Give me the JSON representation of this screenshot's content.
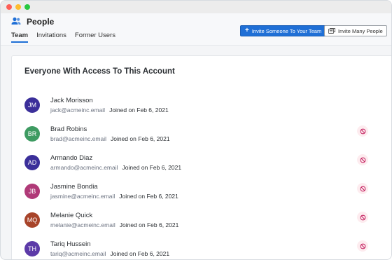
{
  "header": {
    "title": "People",
    "tabs": [
      {
        "label": "Team",
        "active": true
      },
      {
        "label": "Invitations",
        "active": false
      },
      {
        "label": "Former Users",
        "active": false
      }
    ],
    "invite_button": "Invite Someone To Your Team",
    "invite_many_button": "Invite Many People"
  },
  "card": {
    "title": "Everyone With Access To This Account"
  },
  "colors": {
    "accent": "#1f6fd6",
    "remove_icon": "#c2185b"
  },
  "users": [
    {
      "initials": "JM",
      "name": "Jack Morisson",
      "email": "jack@acmeinc.email",
      "joined": "Joined on Feb 6, 2021",
      "avatar_color": "#3b2f9a",
      "removable": false
    },
    {
      "initials": "BR",
      "name": "Brad Robins",
      "email": "brad@acmeinc.email",
      "joined": "Joined on Feb 6, 2021",
      "avatar_color": "#3e9b62",
      "removable": true
    },
    {
      "initials": "AD",
      "name": "Armando Diaz",
      "email": "armando@acmeinc.email",
      "joined": "Joined on Feb 6, 2021",
      "avatar_color": "#3b2f9a",
      "removable": true
    },
    {
      "initials": "JB",
      "name": "Jasmine Bondia",
      "email": "jasmine@acmeinc.email",
      "joined": "Joined on Feb 6, 2021",
      "avatar_color": "#b03a78",
      "removable": true
    },
    {
      "initials": "MQ",
      "name": "Melanie Quick",
      "email": "melanie@acmeinc.email",
      "joined": "Joined on Feb 6, 2021",
      "avatar_color": "#a8442a",
      "removable": true
    },
    {
      "initials": "TH",
      "name": "Tariq Hussein",
      "email": "tariq@acmeinc.email",
      "joined": "Joined on Feb 6, 2021",
      "avatar_color": "#5c3aa8",
      "removable": true
    }
  ]
}
